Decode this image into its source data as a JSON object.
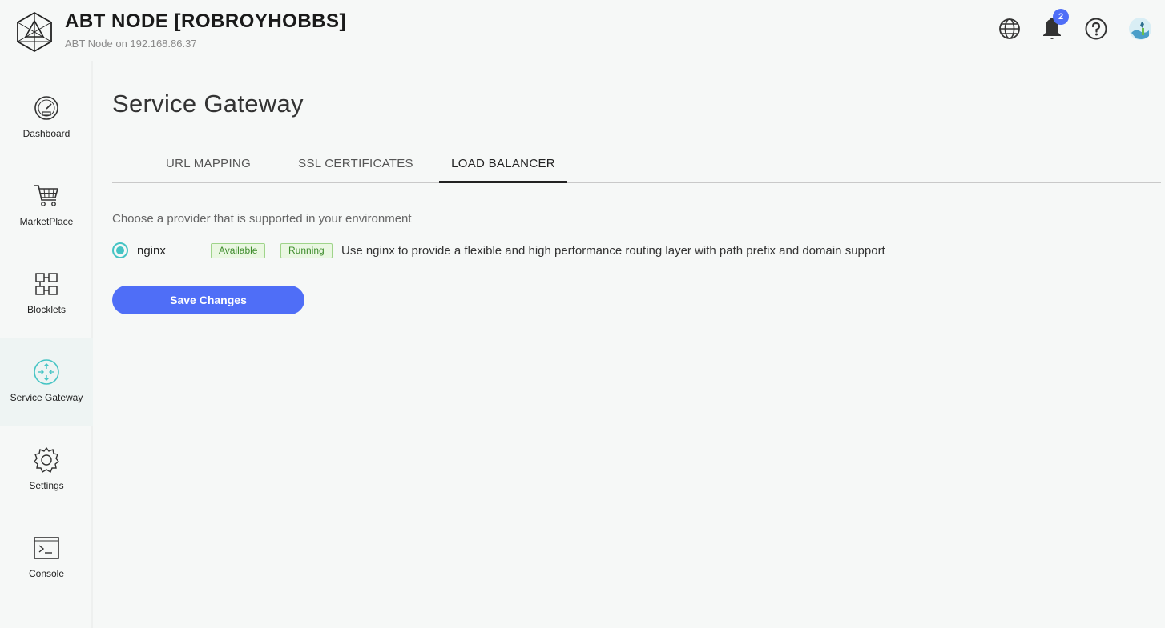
{
  "header": {
    "title": "ABT NODE [ROBROYHOBBS]",
    "subtitle": "ABT Node on 192.168.86.37",
    "notification_count": "2",
    "icons": [
      "globe-icon",
      "bell-icon",
      "help-icon",
      "avatar"
    ]
  },
  "sidebar": {
    "items": [
      {
        "label": "Dashboard",
        "icon": "gauge-icon"
      },
      {
        "label": "MarketPlace",
        "icon": "cart-icon"
      },
      {
        "label": "Blocklets",
        "icon": "blocks-icon"
      },
      {
        "label": "Service Gateway",
        "icon": "gateway-icon",
        "active": true
      },
      {
        "label": "Settings",
        "icon": "gear-icon"
      },
      {
        "label": "Console",
        "icon": "terminal-icon"
      }
    ]
  },
  "main": {
    "page_title": "Service Gateway",
    "tabs": [
      {
        "label": "URL MAPPING"
      },
      {
        "label": "SSL CERTIFICATES"
      },
      {
        "label": "LOAD BALANCER",
        "active": true
      }
    ],
    "description": "Choose a provider that is supported in your environment",
    "provider": {
      "name": "nginx",
      "selected": true,
      "tags": [
        "Available",
        "Running"
      ],
      "description": "Use nginx to provide a flexible and high performance routing layer with path prefix and domain support"
    },
    "save_label": "Save Changes"
  },
  "colors": {
    "accent": "#4f6ef7",
    "radio": "#45c4c4",
    "tag_border": "#9fd48a",
    "tag_text": "#3e8c2c",
    "background": "#f6f8f7"
  }
}
